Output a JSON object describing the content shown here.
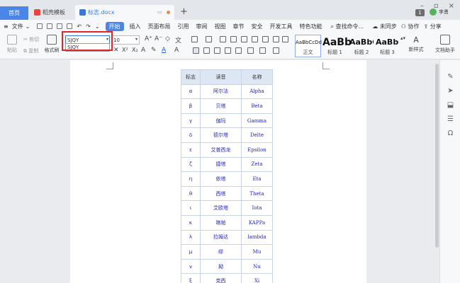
{
  "tabs": {
    "home": "首页",
    "template": "稻壳模板",
    "doc": "标志.docx"
  },
  "window": {
    "badge": "1",
    "user": "李勇"
  },
  "menu": {
    "file": "文件",
    "items": [
      "开始",
      "插入",
      "页面布局",
      "引用",
      "审阅",
      "视图",
      "章节",
      "安全",
      "开发工具",
      "特色功能"
    ],
    "search": "查找命令...",
    "sync": "未同步",
    "collab": "协作",
    "share": "分享"
  },
  "toolbar": {
    "paste": "粘贴",
    "cut": "剪切",
    "copy": "复制",
    "format_painter": "格式刷",
    "font_value": "SJQY",
    "font_suggestion": "SJQY",
    "size_value": "10",
    "styles": [
      {
        "sample": "AaBbCcDd",
        "name": "正文"
      },
      {
        "sample": "AaBb",
        "name": "标题 1"
      },
      {
        "sample": "AaBbC",
        "name": "标题 2"
      },
      {
        "sample": "AaBbC",
        "name": "标题 3"
      }
    ],
    "new_style": "新样式",
    "doc_helper": "文档助手"
  },
  "table": {
    "headers": [
      "标志",
      "读音",
      "名称"
    ],
    "rows": [
      [
        "α",
        "阿尔法",
        "Alpha"
      ],
      [
        "β",
        "贝塔",
        "Beta"
      ],
      [
        "γ",
        "伽玛",
        "Gamma"
      ],
      [
        "δ",
        "德尔塔",
        "Delte"
      ],
      [
        "ε",
        "艾普西龙",
        "Epsilon"
      ],
      [
        "ζ",
        "捷塔",
        "Zeta"
      ],
      [
        "η",
        "依塔",
        "Eta"
      ],
      [
        "θ",
        "西塔",
        "Theta"
      ],
      [
        "ι",
        "艾欧塔",
        "Iota"
      ],
      [
        "κ",
        "喀帕",
        "KAPPa"
      ],
      [
        "λ",
        "拉姆达",
        "lambda"
      ],
      [
        "μ",
        "缪",
        "Mu"
      ],
      [
        "ν",
        "拗",
        "Nu"
      ],
      [
        "ξ",
        "克西",
        "Xi"
      ]
    ]
  },
  "colors": {
    "accent": "#4a86e8",
    "highlight_frame": "#e0262a",
    "table_text": "#2525b8"
  }
}
